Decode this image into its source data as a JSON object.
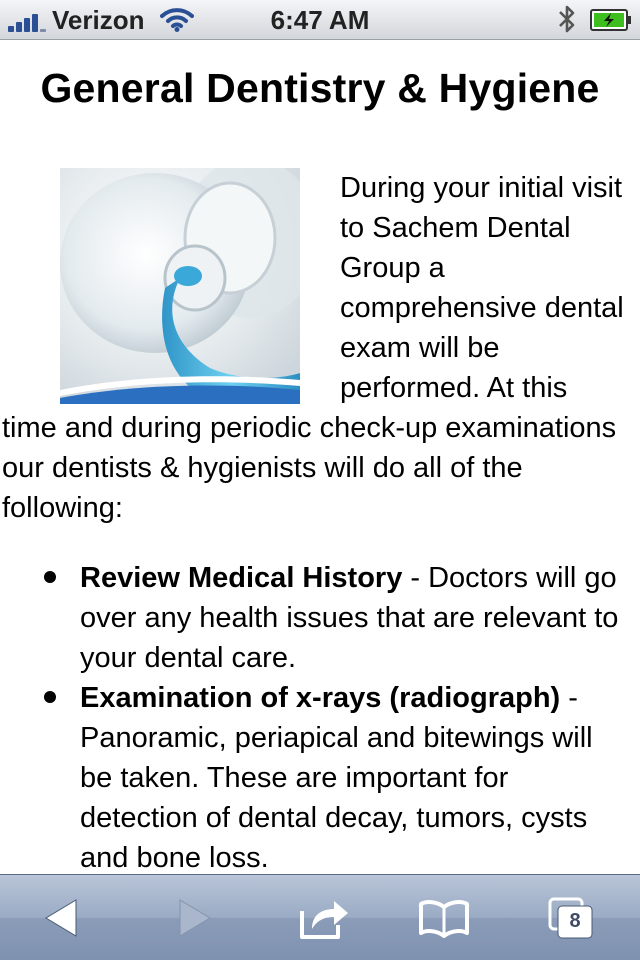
{
  "status_bar": {
    "carrier": "Verizon",
    "time": "6:47 AM"
  },
  "page": {
    "title": "General Dentistry & Hygiene",
    "intro": "During your initial visit to Sachem Dental Group a comprehensive dental exam will be performed. At this time and during periodic check-up examinations our dentists & hygienists will do all of the following:",
    "list": [
      {
        "term": "Review Medical History",
        "description": " - Doctors will go over any health issues that are relevant to your dental care."
      },
      {
        "term": "Examination of x-rays (radiograph)",
        "description": " - Panoramic, periapical and bitewings will be taken. These are important for detection of dental decay, tumors, cysts and bone loss."
      }
    ]
  },
  "toolbar": {
    "pages_count": "8",
    "icons": [
      "back-arrow-icon",
      "forward-arrow-icon",
      "share-icon",
      "bookmarks-icon",
      "pages-icon"
    ]
  },
  "colors": {
    "toolbar": "#8a9cb8",
    "status_bar": "#d3d6db",
    "battery_green": "#3fbf1f",
    "toothpaste_blue": "#3aa8d8"
  }
}
